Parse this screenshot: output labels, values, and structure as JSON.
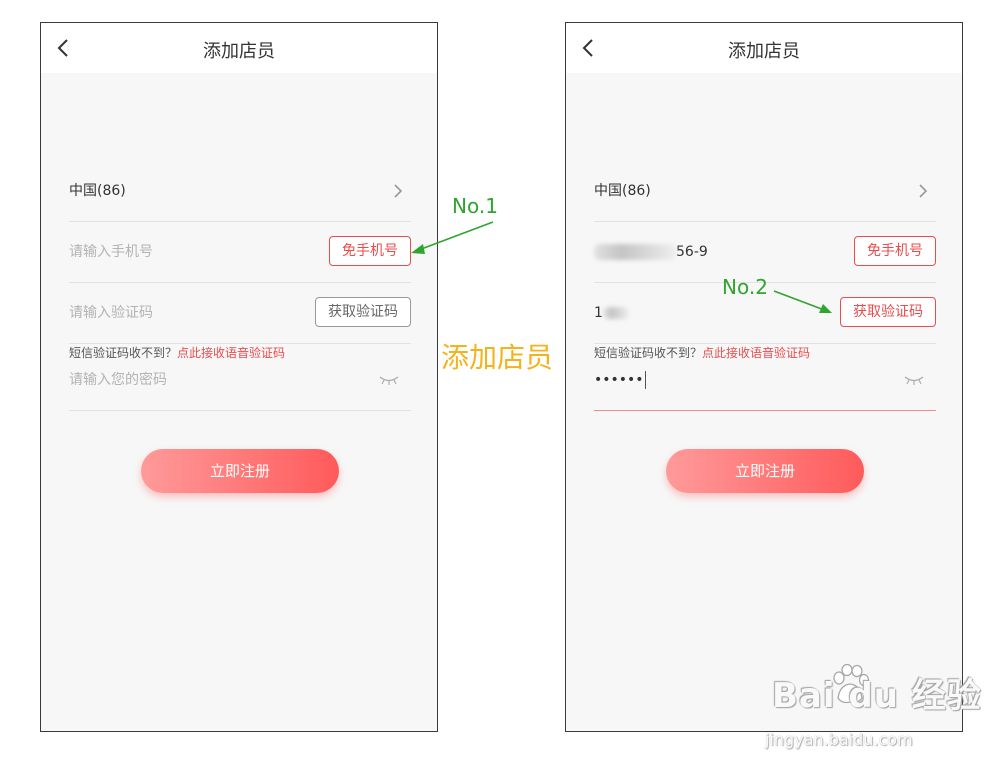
{
  "left_screen": {
    "title": "添加店员",
    "country": "中国(86)",
    "phone_placeholder": "请输入手机号",
    "phone_button": "免手机号",
    "code_placeholder": "请输入验证码",
    "code_button": "获取验证码",
    "hint_text": "短信验证码收不到？",
    "hint_link": "点此接收语音验证码",
    "password_placeholder": "请输入您的密码",
    "submit_label": "立即注册"
  },
  "right_screen": {
    "title": "添加店员",
    "country": "中国(86)",
    "phone_value_suffix": "56-9",
    "phone_button": "免手机号",
    "code_value_prefix": "1",
    "code_button": "获取验证码",
    "hint_text": "短信验证码收不到？",
    "hint_link": "点此接收语音验证码",
    "password_value": "••••••",
    "submit_label": "立即注册"
  },
  "annotations": {
    "no1": "No.1",
    "no2": "No.2",
    "center_title": "添加店员"
  },
  "watermark": {
    "brand": "Bai  du 经验",
    "url": "jingyan.baidu.com"
  },
  "colors": {
    "accent_red": "#e84c4c",
    "annotation_green": "#2fa52f",
    "center_title_orange": "#f5b21b"
  }
}
